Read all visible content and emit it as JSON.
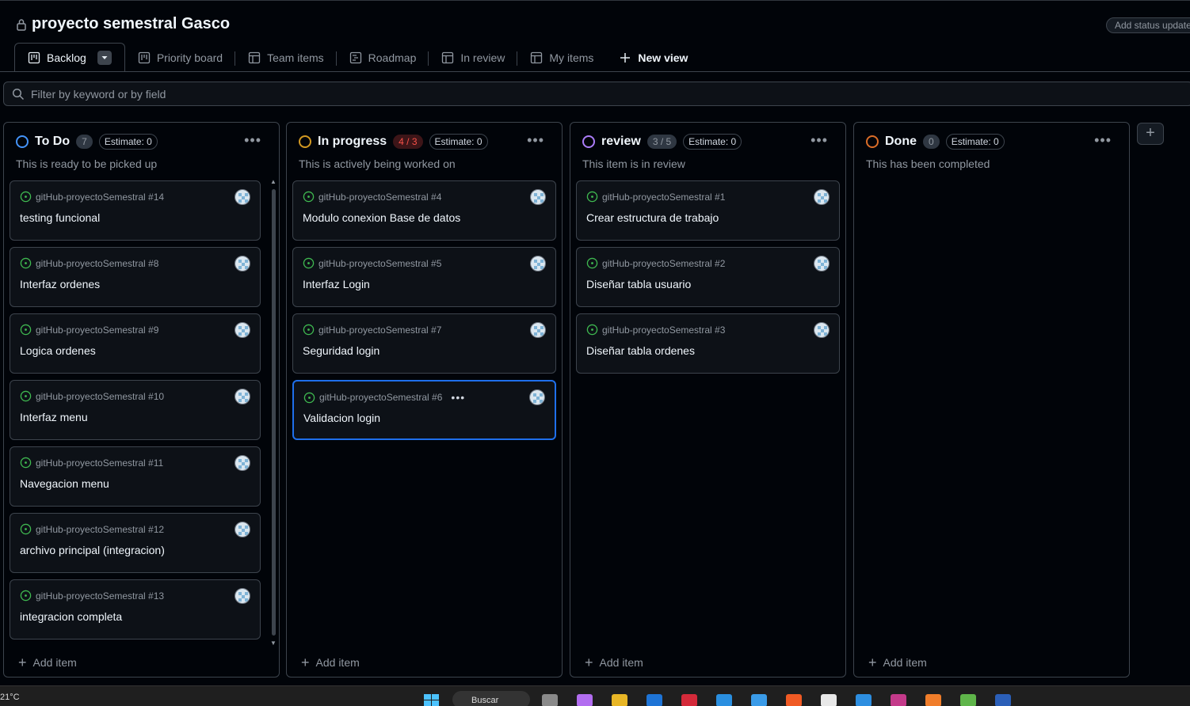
{
  "header": {
    "title": "proyecto semestral Gasco",
    "status_button": "Add status update"
  },
  "tabs": [
    {
      "label": "Backlog",
      "icon": "board-icon",
      "active": true
    },
    {
      "label": "Priority board",
      "icon": "board-icon"
    },
    {
      "label": "Team items",
      "icon": "table-icon"
    },
    {
      "label": "Roadmap",
      "icon": "roadmap-icon"
    },
    {
      "label": "In review",
      "icon": "table-icon"
    },
    {
      "label": "My items",
      "icon": "table-icon"
    },
    {
      "label": "New view",
      "icon": "plus-icon"
    }
  ],
  "filter": {
    "placeholder": "Filter by keyword or by field"
  },
  "columns": [
    {
      "name": "To Do",
      "count": "7",
      "estimate": "Estimate: 0",
      "description": "This is ready to be picked up",
      "color": "#4493f8",
      "add_item": "Add item",
      "cards": [
        {
          "ref": "gitHub-proyectoSemestral #14",
          "title": "testing funcional"
        },
        {
          "ref": "gitHub-proyectoSemestral #8",
          "title": "Interfaz ordenes"
        },
        {
          "ref": "gitHub-proyectoSemestral #9",
          "title": "Logica ordenes"
        },
        {
          "ref": "gitHub-proyectoSemestral #10",
          "title": "Interfaz menu"
        },
        {
          "ref": "gitHub-proyectoSemestral #11",
          "title": "Navegacion menu"
        },
        {
          "ref": "gitHub-proyectoSemestral #12",
          "title": "archivo principal (integracion)"
        },
        {
          "ref": "gitHub-proyectoSemestral #13",
          "title": "integracion completa"
        }
      ]
    },
    {
      "name": "In progress",
      "count": "4 / 3",
      "estimate": "Estimate: 0",
      "description": "This is actively being worked on",
      "color": "#d29922",
      "add_item": "Add item",
      "cards": [
        {
          "ref": "gitHub-proyectoSemestral #4",
          "title": "Modulo conexion Base de datos"
        },
        {
          "ref": "gitHub-proyectoSemestral #5",
          "title": "Interfaz Login"
        },
        {
          "ref": "gitHub-proyectoSemestral #7",
          "title": "Seguridad login"
        },
        {
          "ref": "gitHub-proyectoSemestral #6",
          "title": "Validacion login"
        }
      ]
    },
    {
      "name": "review",
      "count": "3 / 5",
      "estimate": "Estimate: 0",
      "description": "This item is in review",
      "color": "#ab7df8",
      "add_item": "Add item",
      "cards": [
        {
          "ref": "gitHub-proyectoSemestral #1",
          "title": "Crear estructura de trabajo"
        },
        {
          "ref": "gitHub-proyectoSemestral #2",
          "title": "Diseñar tabla usuario"
        },
        {
          "ref": "gitHub-proyectoSemestral #3",
          "title": "Diseñar tabla ordenes"
        }
      ]
    },
    {
      "name": "Done",
      "count": "0",
      "estimate": "Estimate: 0",
      "description": "This has been completed",
      "color": "#db6d28",
      "add_item": "Add item",
      "cards": []
    }
  ],
  "taskbar": {
    "weather": "21°C",
    "search": "Buscar"
  }
}
